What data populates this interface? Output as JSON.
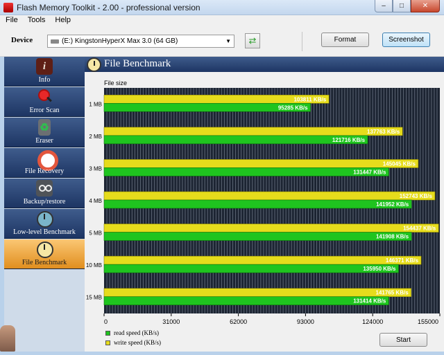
{
  "window": {
    "title": "Flash Memory Toolkit - 2.00 - professional version",
    "buttons": [
      "–",
      "□",
      "✕"
    ]
  },
  "menu": [
    "File",
    "Tools",
    "Help"
  ],
  "toolbar": {
    "device_label": "Device",
    "device_value": "(E:) KingstonHyperX Max 3.0 (64 GB)",
    "refresh_icon": "refresh-icon",
    "format_label": "Format",
    "screenshot_label": "Screenshot"
  },
  "sidebar": {
    "items": [
      {
        "label": "Info",
        "icon": "info-icon",
        "glyph": "i"
      },
      {
        "label": "Error Scan",
        "icon": "magnifier-icon",
        "glyph": ""
      },
      {
        "label": "Eraser",
        "icon": "recycle-bin-icon",
        "glyph": "♻"
      },
      {
        "label": "File Recovery",
        "icon": "lifebuoy-icon",
        "glyph": ""
      },
      {
        "label": "Backup/restore",
        "icon": "tape-icon",
        "glyph": ""
      },
      {
        "label": "Low-level Benchmark",
        "icon": "clock-icon",
        "glyph": ""
      },
      {
        "label": "File Benchmark",
        "icon": "clock-icon",
        "glyph": ""
      }
    ],
    "active_index": 6
  },
  "page_title": "File Benchmark",
  "colors": {
    "read": "#1fc41f",
    "write": "#e6dc1c",
    "plot_bg": "#1c2432",
    "nav": "#2a4676",
    "nav_active": "#f0a540"
  },
  "chart_data": {
    "type": "bar",
    "orientation": "horizontal",
    "y_title": "File size",
    "categories": [
      "1 MB",
      "2 MB",
      "3 MB",
      "4 MB",
      "5 MB",
      "10 MB",
      "15 MB"
    ],
    "series": [
      {
        "name": "write speed (KB/s)",
        "values": [
          103811,
          137763,
          145045,
          152743,
          154437,
          146371,
          141765
        ]
      },
      {
        "name": "read speed (KB/s)",
        "values": [
          95285,
          121716,
          131447,
          141952,
          141908,
          135950,
          131414
        ]
      }
    ],
    "value_suffix": " KB/s",
    "xlim": [
      0,
      155000
    ],
    "xticks": [
      0,
      31000,
      62000,
      93000,
      124000,
      155000
    ],
    "xtick_labels": [
      "0",
      "31000",
      "62000",
      "93000",
      "124000",
      "155000"
    ],
    "legend": [
      "read speed (KB/s)",
      "write speed (KB/s)"
    ],
    "grid": true
  },
  "start_label": "Start"
}
